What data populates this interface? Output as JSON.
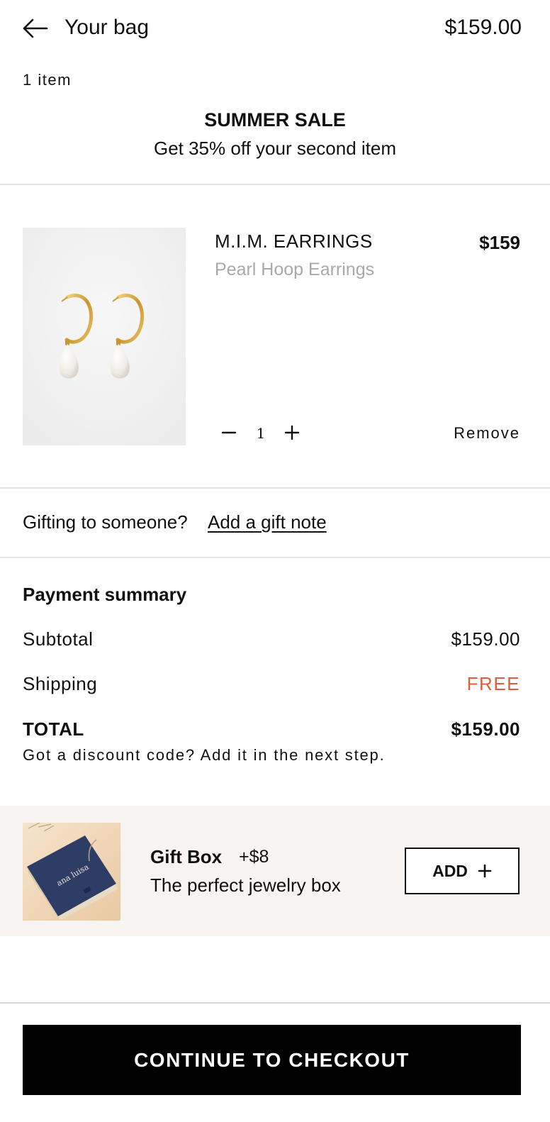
{
  "header": {
    "title": "Your bag",
    "total": "$159.00",
    "item_count": "1 item",
    "icons": {
      "back": "arrow-left-icon"
    }
  },
  "promo": {
    "title": "SUMMER SALE",
    "subtitle": "Get 35% off your second item"
  },
  "cart": {
    "items": [
      {
        "brand": "M.I.M. EARRINGS",
        "name": "Pearl Hoop Earrings",
        "price": "$159",
        "quantity": "1",
        "remove_label": "Remove",
        "image": "pearl-hoop-earrings-photo",
        "icons": {
          "decrease": "minus-icon",
          "increase": "plus-icon"
        }
      }
    ]
  },
  "gift_note": {
    "question": "Gifting to someone?",
    "link": "Add a gift note"
  },
  "summary": {
    "title": "Payment summary",
    "rows": [
      {
        "label": "Subtotal",
        "value": "$159.00"
      },
      {
        "label": "Shipping",
        "value": "FREE"
      }
    ],
    "total_label": "TOTAL",
    "total_value": "$159.00",
    "discount_note": "Got a discount code? Add it in the next step."
  },
  "upsell": {
    "name": "Gift Box",
    "price": "+$8",
    "description": "The perfect jewelry box",
    "button_label": "ADD",
    "image": "jewelry-gift-box-photo",
    "box_text": "ana luisa",
    "icon": "plus-icon"
  },
  "checkout": {
    "label": "CONTINUE TO CHECKOUT"
  },
  "colors": {
    "accent_free": "#e25b3d",
    "upsell_bg": "#f8f4f1",
    "button_bg": "#000000"
  }
}
